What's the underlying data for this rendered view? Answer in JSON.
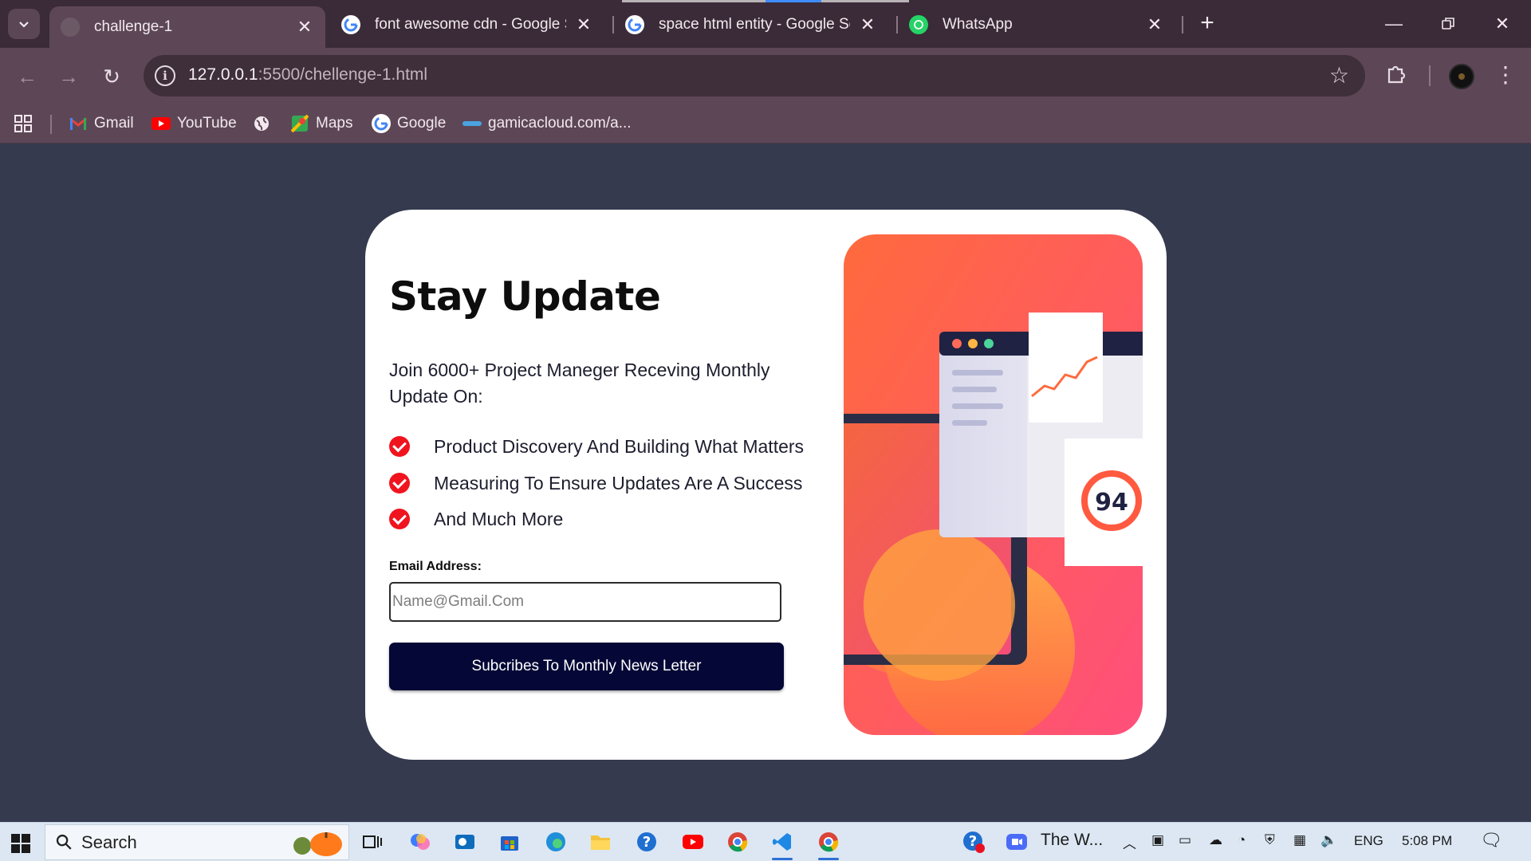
{
  "browser": {
    "tabs": [
      {
        "title": "challenge-1",
        "active": true,
        "favicon": "globe-icon"
      },
      {
        "title": "font awesome cdn - Google Se",
        "active": false,
        "favicon": "google-icon"
      },
      {
        "title": "space html entity - Google Sear",
        "active": false,
        "favicon": "google-icon"
      },
      {
        "title": "WhatsApp",
        "active": false,
        "favicon": "whatsapp-icon"
      }
    ],
    "url_host": "127.0.0.1",
    "url_path": ":5500/chellenge-1.html",
    "bookmarks": [
      {
        "label": "Gmail",
        "icon": "gmail-icon"
      },
      {
        "label": "YouTube",
        "icon": "youtube-icon"
      },
      {
        "label": "",
        "icon": "globe-icon"
      },
      {
        "label": "Maps",
        "icon": "maps-icon"
      },
      {
        "label": "Google",
        "icon": "google-icon"
      },
      {
        "label": "gamicacloud.com/a...",
        "icon": "gamica-icon"
      }
    ]
  },
  "page": {
    "title": "Stay Update",
    "intro": "Join 6000+ Project Maneger Receving Monthly Update On:",
    "features": [
      "Product Discovery And Building What Matters",
      "Measuring To Ensure Updates Are A Success",
      "And Much More"
    ],
    "email_label": "Email Address:",
    "email_placeholder": "Name@Gmail.Com",
    "email_value": "",
    "submit_label": "Subcribes To Monthly News Letter",
    "illustration_score": "94",
    "colors": {
      "background": "#363a4f",
      "card": "#ffffff",
      "button": "#050836",
      "check": "#f0141e",
      "gradient_start": "#ff6a3d",
      "gradient_end": "#ff5a7a"
    }
  },
  "taskbar": {
    "search_label": "Search",
    "pinned_window_title": "The W...",
    "language": "ENG",
    "time": "5:08 PM"
  }
}
